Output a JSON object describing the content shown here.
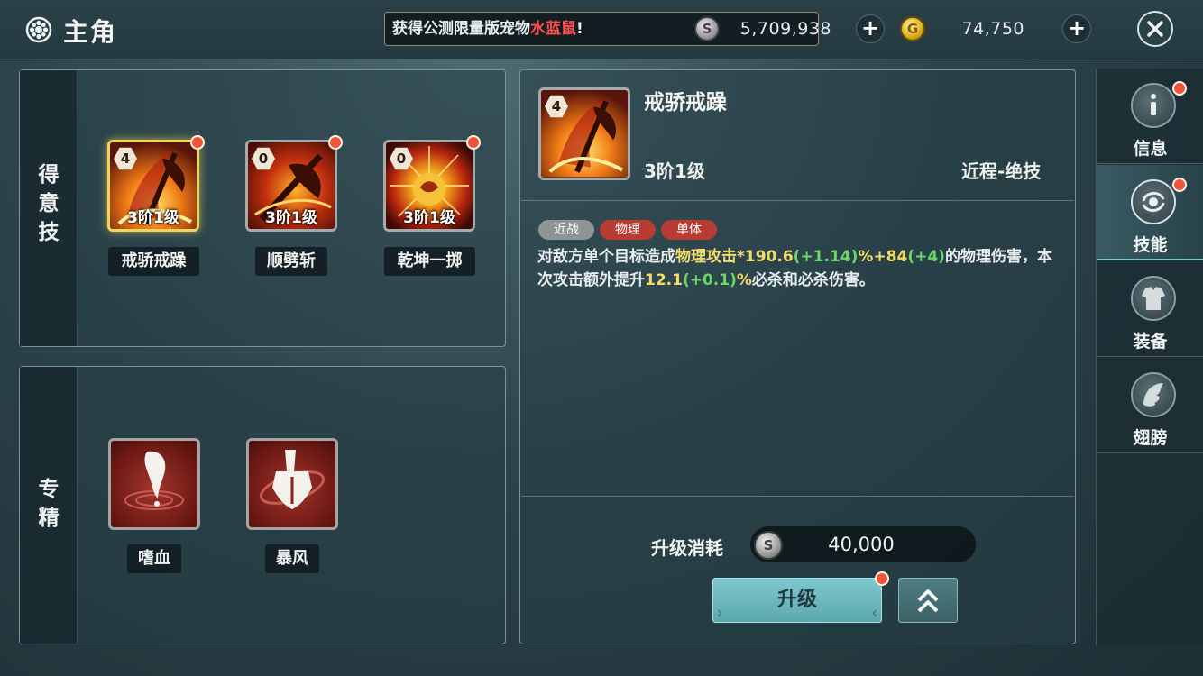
{
  "header": {
    "title": "主角",
    "marquee_prefix": "获得公测限量版宠物",
    "marquee_highlight": "水蓝鼠",
    "marquee_suffix": "!",
    "silver": "5,709,938",
    "gold": "74,750",
    "plus": "+"
  },
  "panels": {
    "favorite_label": "得意技",
    "spec_label": "专精"
  },
  "skills": [
    {
      "name": "戒骄戒躁",
      "badge": "4",
      "level": "3阶1级"
    },
    {
      "name": "顺劈斩",
      "badge": "0",
      "level": "3阶1级"
    },
    {
      "name": "乾坤一掷",
      "badge": "0",
      "level": "3阶1级"
    }
  ],
  "specs": [
    {
      "name": "嗜血"
    },
    {
      "name": "暴风"
    }
  ],
  "detail": {
    "badge": "4",
    "title": "戒骄戒躁",
    "level": "3阶1级",
    "type": "近程-绝技",
    "tags": [
      "近战",
      "物理",
      "单体"
    ],
    "desc": {
      "p1": "对敌方单个目标造成",
      "h1": "物理攻击*190.6",
      "g1": "(+1.14)",
      "h2": "%+84",
      "g2": "(+4)",
      "p2": "的物理伤害，本次攻击额外提升",
      "h3": "12.1",
      "g3": "(+0.1)",
      "h4": "%",
      "p3": "必杀和必杀伤害。"
    },
    "cost_label": "升级消耗",
    "cost_value": "40,000",
    "upgrade_label": "升级"
  },
  "nav": [
    {
      "label": "信息"
    },
    {
      "label": "技能"
    },
    {
      "label": "装备"
    },
    {
      "label": "翅膀"
    }
  ],
  "colors": {
    "accent_teal": "#5aa8ae",
    "selected_gold": "#f2d55a",
    "notify_red": "#ef5434",
    "highlight_yellow": "#f1dc6b",
    "bonus_green": "#6bd56b",
    "tag_gray": "#8f9496",
    "tag_red": "#b73c33"
  }
}
